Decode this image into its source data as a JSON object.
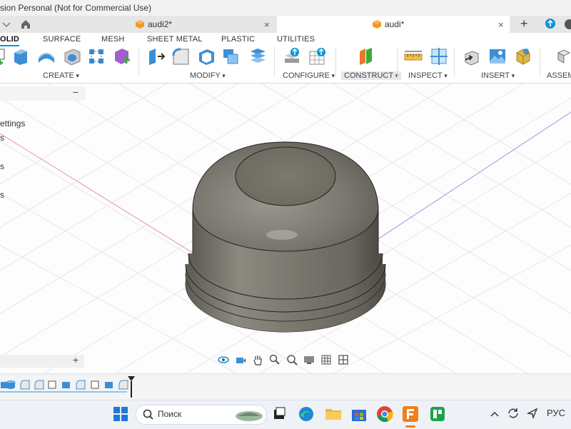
{
  "window": {
    "title": "sion Personal (Not for Commercial Use)"
  },
  "tabs": [
    {
      "label": "audi2*",
      "active": false
    },
    {
      "label": "audi*",
      "active": true
    }
  ],
  "tab_actions": {
    "new_tab": "+",
    "close": "×"
  },
  "ribbon": {
    "tabs": [
      "OLID",
      "SURFACE",
      "MESH",
      "SHEET METAL",
      "PLASTIC",
      "UTILITIES"
    ],
    "groups": [
      "CREATE",
      "MODIFY",
      "CONFIGURE",
      "CONSTRUCT",
      "INSPECT",
      "INSERT",
      "ASSEM"
    ]
  },
  "browser": {
    "collapse": "−",
    "items": [
      "ettings",
      "s",
      "s",
      "s"
    ]
  },
  "comments": {
    "add": "+"
  },
  "taskbar": {
    "search_placeholder": "Поиск",
    "language": "РУС"
  },
  "colors": {
    "accent": "#0696d7",
    "model_body": "#7a776f",
    "grid_line": "#e2e2e2",
    "x_axis": "#e69a9a",
    "y_axis": "#9a9ae6"
  }
}
